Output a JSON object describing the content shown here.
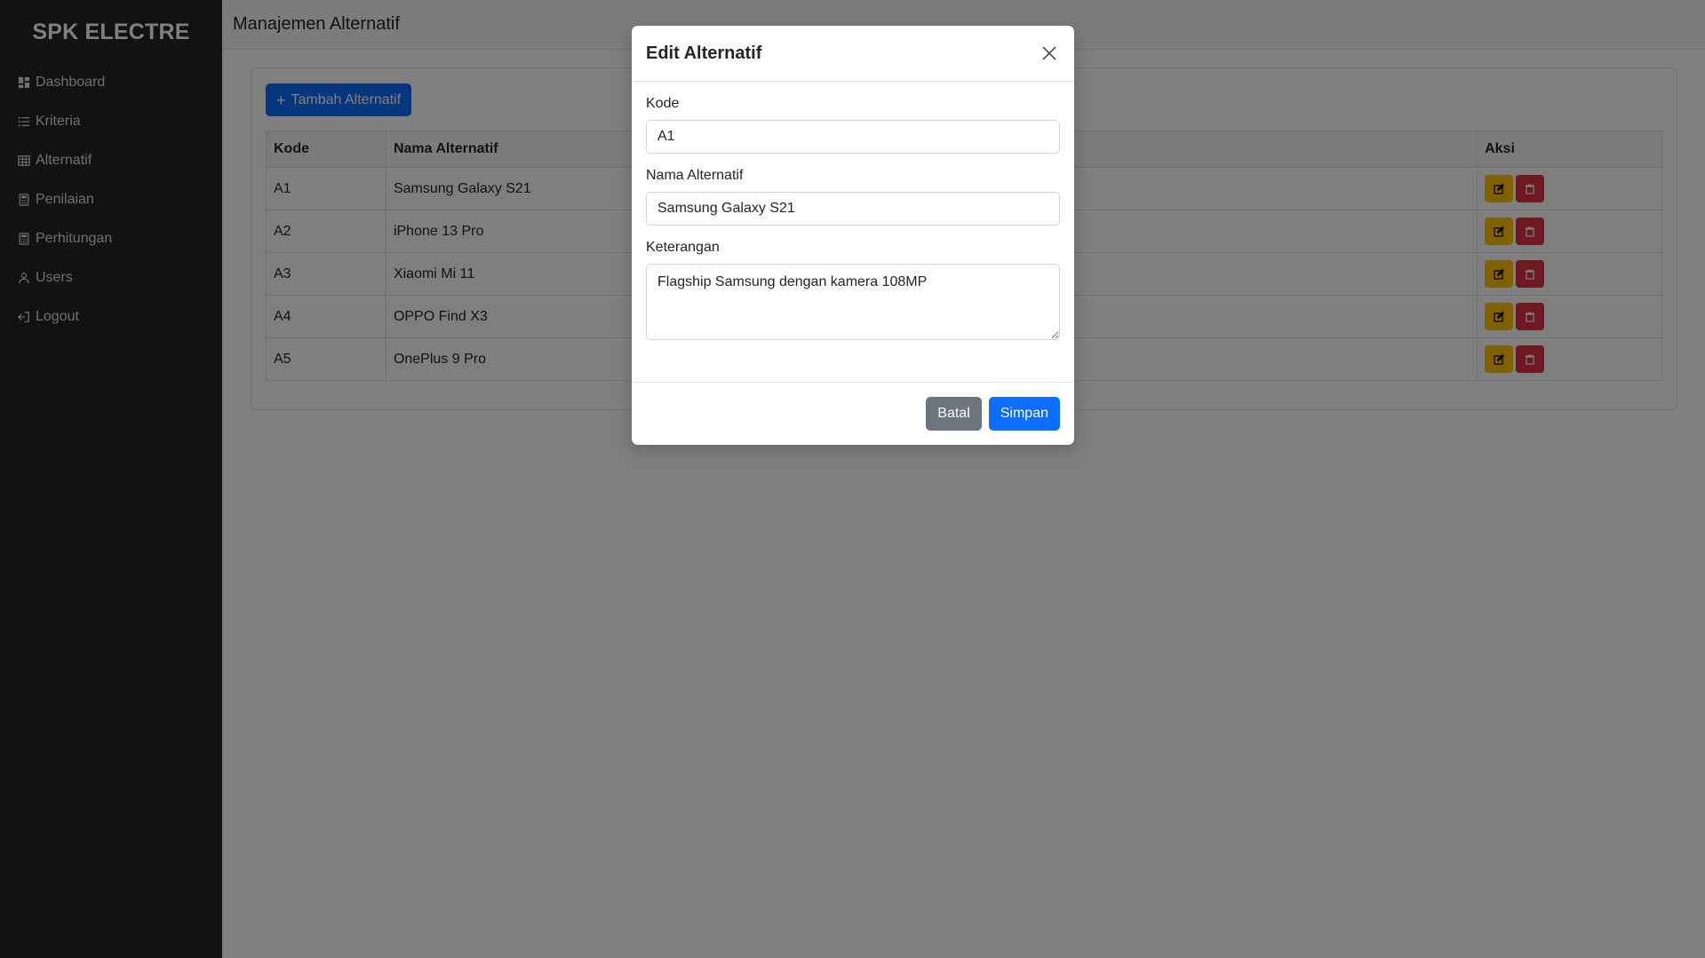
{
  "sidebar": {
    "brand": "SPK ELECTRE",
    "items": [
      {
        "label": "Dashboard",
        "icon": "dashboard-icon"
      },
      {
        "label": "Kriteria",
        "icon": "list-icon"
      },
      {
        "label": "Alternatif",
        "icon": "table-icon"
      },
      {
        "label": "Penilaian",
        "icon": "calculator-icon"
      },
      {
        "label": "Perhitungan",
        "icon": "calculator-icon"
      },
      {
        "label": "Users",
        "icon": "user-icon"
      },
      {
        "label": "Logout",
        "icon": "logout-icon"
      }
    ]
  },
  "header": {
    "title": "Manajemen Alternatif"
  },
  "toolbar": {
    "add_label": "Tambah Alternatif"
  },
  "table": {
    "headers": {
      "kode": "Kode",
      "nama": "Nama Alternatif",
      "aksi": "Aksi"
    },
    "rows": [
      {
        "kode": "A1",
        "nama": "Samsung Galaxy S21"
      },
      {
        "kode": "A2",
        "nama": "iPhone 13 Pro"
      },
      {
        "kode": "A3",
        "nama": "Xiaomi Mi 11"
      },
      {
        "kode": "A4",
        "nama": "OPPO Find X3"
      },
      {
        "kode": "A5",
        "nama": "OnePlus 9 Pro"
      }
    ]
  },
  "modal": {
    "title": "Edit Alternatif",
    "kode_label": "Kode",
    "kode_value": "A1",
    "nama_label": "Nama Alternatif",
    "nama_value": "Samsung Galaxy S21",
    "keterangan_label": "Keterangan",
    "keterangan_value": "Flagship Samsung dengan kamera 108MP",
    "cancel_label": "Batal",
    "save_label": "Simpan"
  },
  "colors": {
    "sidebar_bg": "#212529",
    "primary": "#0d6efd",
    "secondary": "#6c757d",
    "warning": "#ffc107",
    "danger": "#dc3545"
  }
}
